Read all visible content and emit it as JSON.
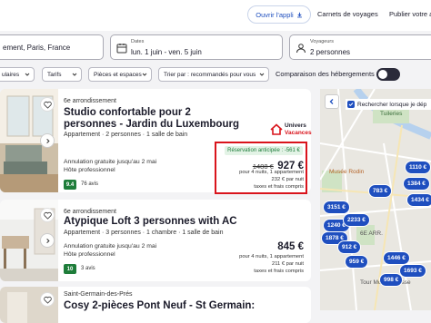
{
  "header": {
    "app_button": "Ouvrir l'appli",
    "links": [
      "Carnets de voyages",
      "Publier votre ann"
    ]
  },
  "search": {
    "destination": "ement, Paris, France",
    "dates_label": "Dates",
    "dates_value": "lun. 1 juin - ven. 5 juin",
    "guests_label": "Voyageurs",
    "guests_value": "2 personnes"
  },
  "filters": {
    "chips": [
      "ulaires",
      "Tarifs",
      "Pièces et espaces",
      "Trier par : recommandés pour vous"
    ],
    "compare_label": "Comparaison des hébergements"
  },
  "listings": [
    {
      "location": "6e arrondissement",
      "title": "Studio confortable pour 2 personnes - Jardin du Luxembourg",
      "details": "Appartement · 2 personnes · 1 salle de bain",
      "cancel": "Annulation gratuite jusqu'au 2 mai",
      "host": "Hôte professionnel",
      "score": "9.4",
      "reviews": "76 avis",
      "brand_top": "Univers",
      "brand_bottom": "Vacances",
      "deal": "Réservation anticipée : -561 €",
      "old_price": "1488 €",
      "price": "927 €",
      "price_desc": "pour 4 nuits, 1 appartement",
      "per_night": "232 € par nuit",
      "fees": "taxes et frais compris"
    },
    {
      "location": "6e arrondissement",
      "title": "Atypique Loft 3 personnes with AC",
      "details": "Appartement · 3 personnes · 1 chambre · 1 salle de bain",
      "cancel": "Annulation gratuite jusqu'au 2 mai",
      "host": "Hôte professionnel",
      "score": "10",
      "reviews": "3 avis",
      "price": "845 €",
      "price_desc": "pour 4 nuits, 1 appartement",
      "per_night": "211 € par nuit",
      "fees": "taxes et frais compris"
    },
    {
      "location": "Saint-Germain-des-Prés",
      "title": "Cosy 2-pièces Pont Neuf - St Germain:"
    }
  ],
  "map": {
    "search_toggle": "Rechercher lorsque je dép",
    "labels": [
      "Tuileries",
      "Musée Rodin",
      "6E ARR.",
      "Tour Montparnasse"
    ],
    "pins": [
      "1110 €",
      "1384 €",
      "783 €",
      "1434 €",
      "3151 €",
      "1240 €",
      "2233 €",
      "1878 €",
      "912 €",
      "959 €",
      "1446 €",
      "1693 €",
      "998 €"
    ]
  },
  "colors": {
    "accent": "#1f4fbf",
    "highlight_border": "#d9141c",
    "score_green": "#1e7d3a",
    "deal_green": "#1e7d3a"
  }
}
